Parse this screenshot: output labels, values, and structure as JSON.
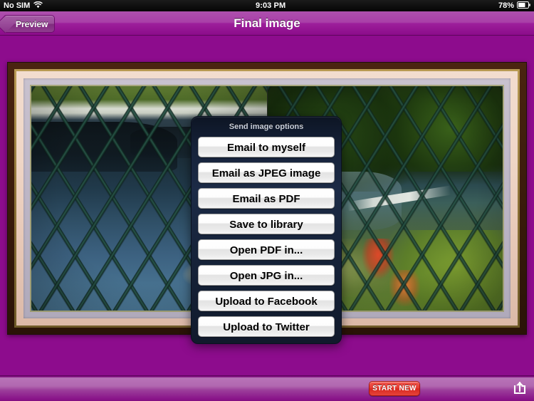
{
  "status_bar": {
    "carrier": "No SIM",
    "wifi_icon": "wifi-icon",
    "time": "9:03 PM",
    "battery_percent": "78%",
    "battery_icon": "battery-icon"
  },
  "nav_bar": {
    "back_label": "Preview",
    "title": "Final image"
  },
  "action_sheet": {
    "title": "Send image options",
    "buttons": [
      {
        "label": "Email to myself"
      },
      {
        "label": "Email as JPEG image"
      },
      {
        "label": "Email as PDF"
      },
      {
        "label": "Save to library"
      },
      {
        "label": "Open PDF in..."
      },
      {
        "label": "Open JPG in..."
      },
      {
        "label": "Upload to Facebook"
      },
      {
        "label": "Upload to Twitter"
      }
    ]
  },
  "toolbar": {
    "start_new_label": "START NEW",
    "share_icon": "share-icon"
  },
  "canvas": {
    "background_color": "#8d0c8d",
    "frame": {
      "photos": [
        {
          "name": "photo-chainlink-over-water"
        },
        {
          "name": "photo-chainlink-over-pond-garden"
        }
      ]
    }
  },
  "colors": {
    "page_background": "#8d0c8d",
    "nav_bar_accent": "#a93fa8",
    "start_new_red": "#e63d33",
    "sheet_dark_navy": "#16223a"
  }
}
